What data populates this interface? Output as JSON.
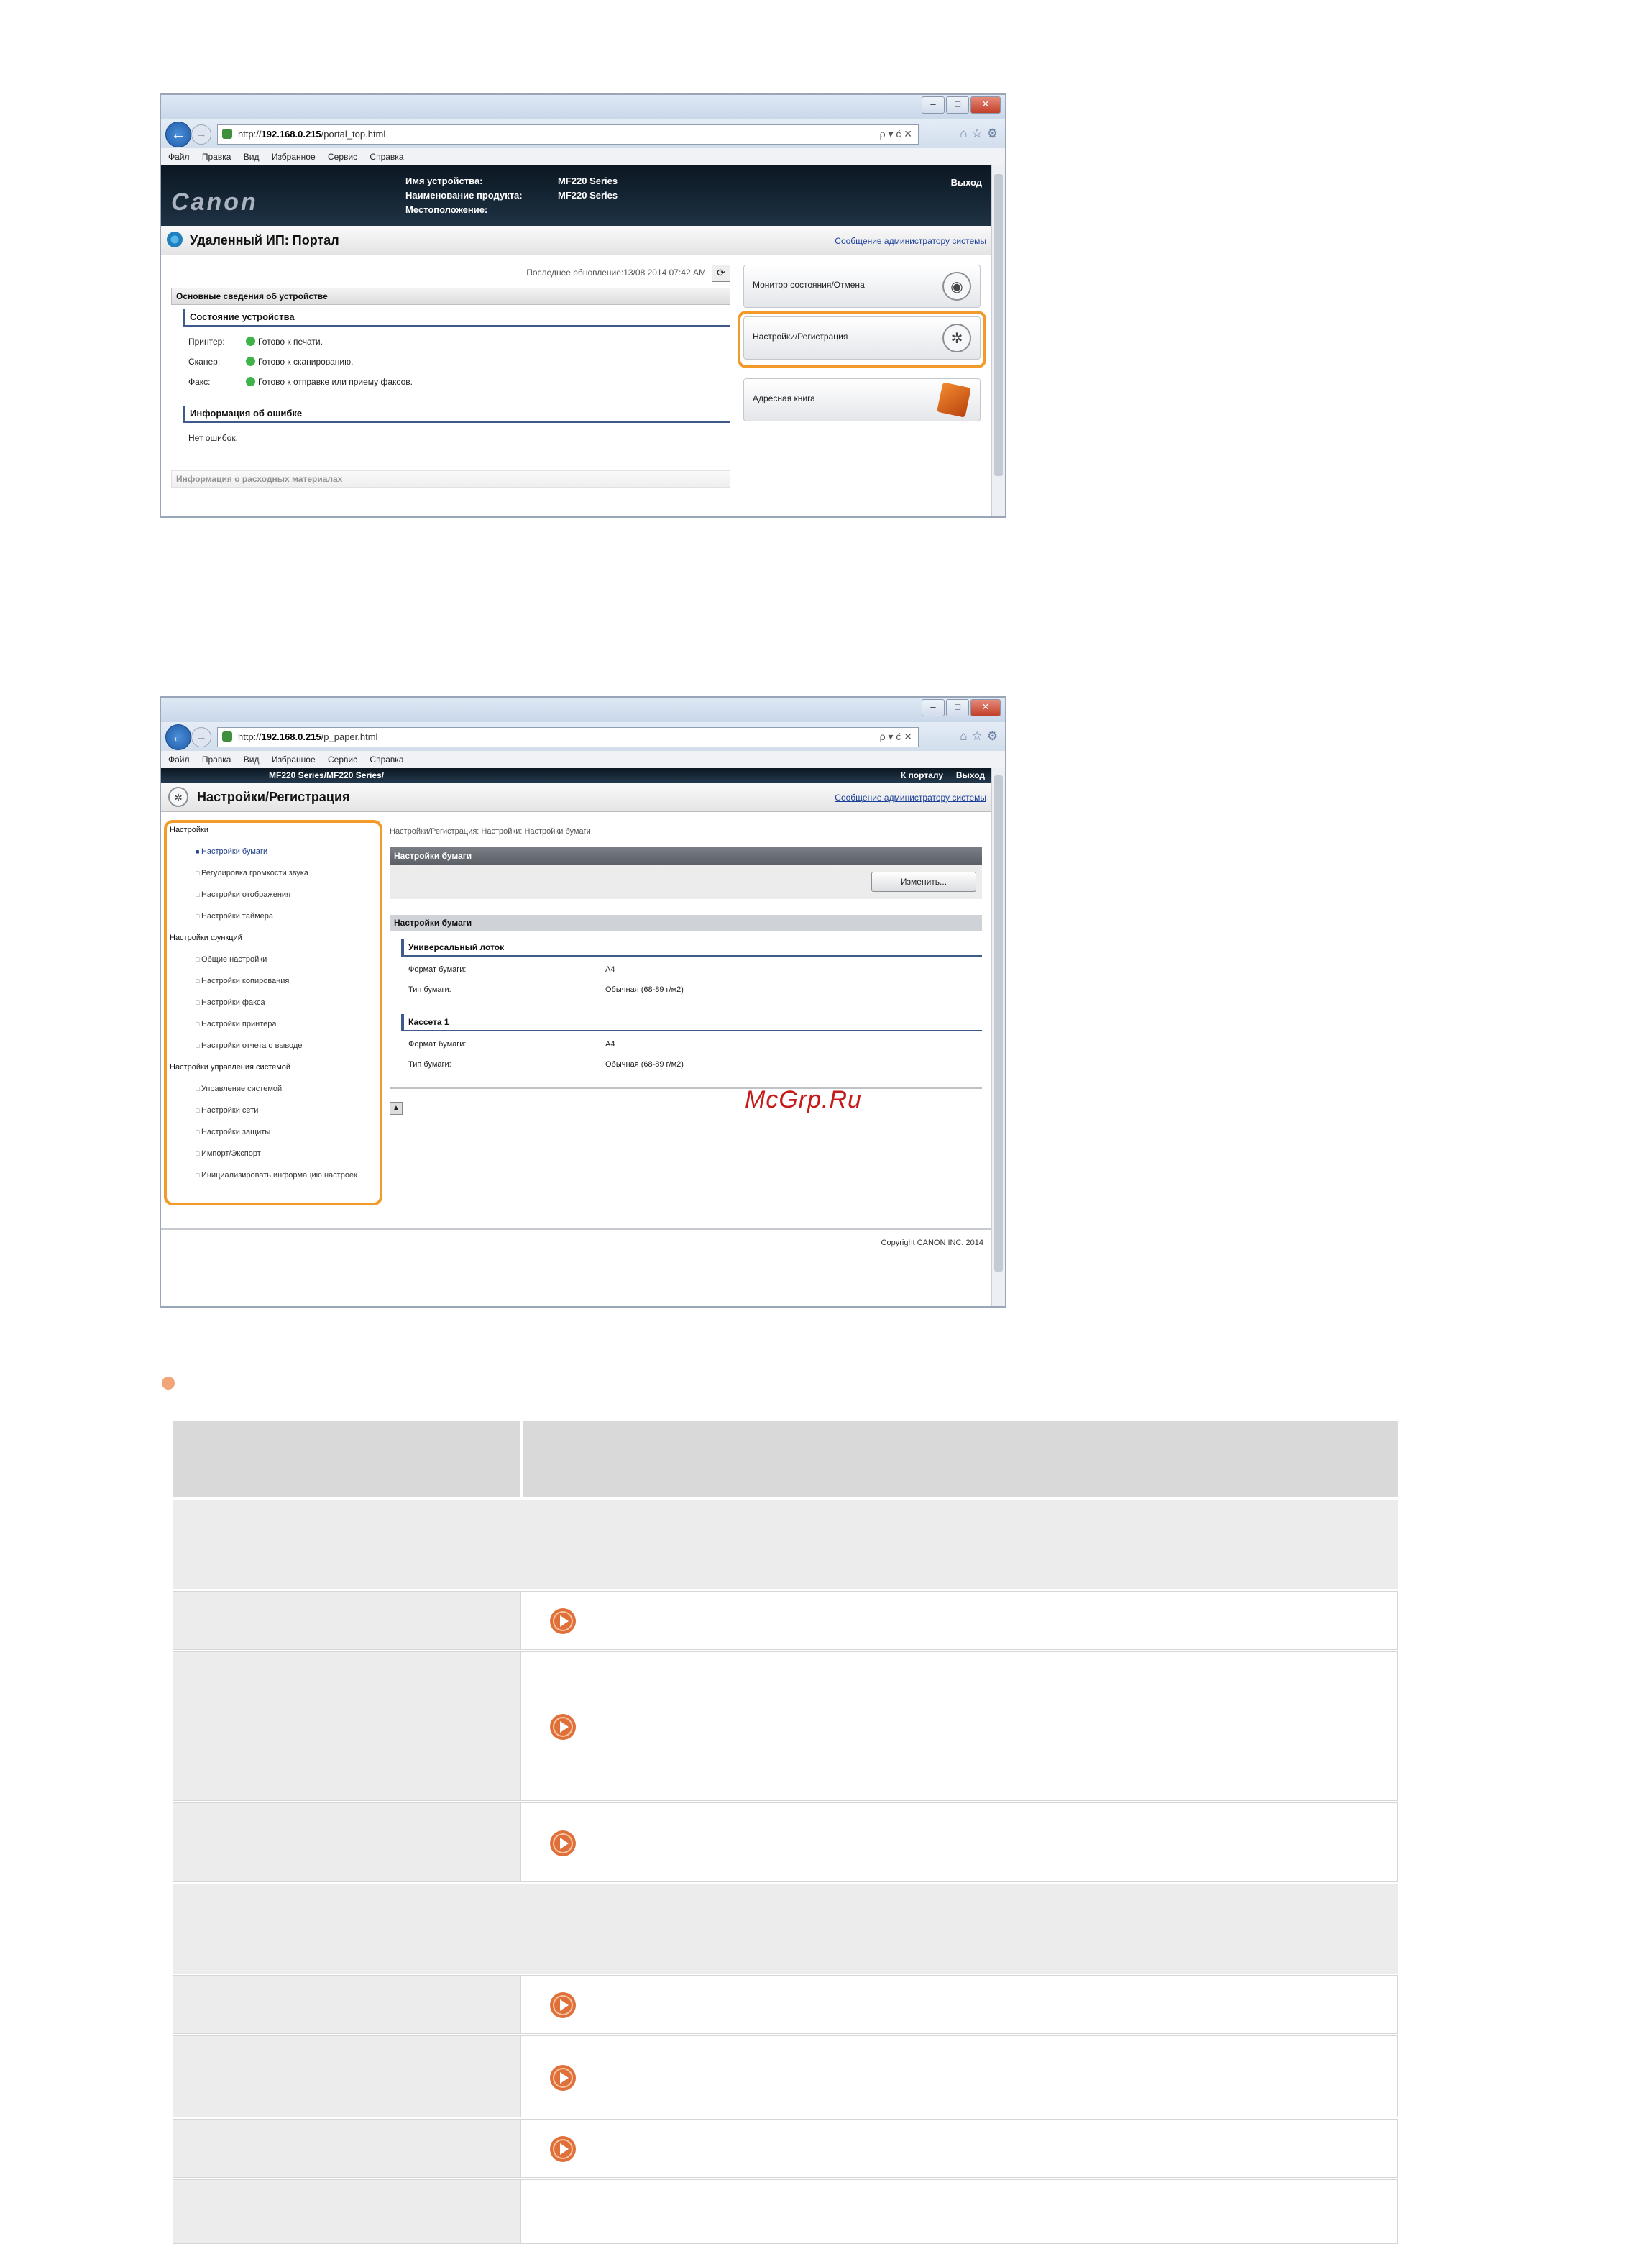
{
  "screenshot1": {
    "url_prefix": "http://",
    "url_host": "192.168.0.215",
    "url_path": "/portal_top.html",
    "addr_controls": "ρ ▾ ć ✕",
    "menu": [
      "Файл",
      "Правка",
      "Вид",
      "Избранное",
      "Сервис",
      "Справка"
    ],
    "device_labels": [
      "Имя устройства:",
      "Наименование продукта:",
      "Местоположение:"
    ],
    "device_values": [
      "MF220 Series",
      "MF220 Series",
      ""
    ],
    "logout": "Выход",
    "page_title": "Удаленный ИП: Портал",
    "admin_link": "Сообщение администратору системы",
    "last_update": "Последнее обновление:13/08 2014 07:42 AM",
    "section_basic": "Основные сведения об устройстве",
    "section_status": "Состояние устройства",
    "status_rows": [
      {
        "key": "Принтер:",
        "value": "Готово к печати."
      },
      {
        "key": "Сканер:",
        "value": "Готово к сканированию."
      },
      {
        "key": "Факс:",
        "value": "Готово к отправке или приему факсов."
      }
    ],
    "section_errors": "Информация об ошибке",
    "no_errors": "Нет ошибок.",
    "section_consumables": "Информация о расходных материалах",
    "side_cards": [
      "Монитор состояния/Отмена",
      "Настройки/Регистрация",
      "Адресная книга"
    ]
  },
  "screenshot2": {
    "url_prefix": "http://",
    "url_host": "192.168.0.215",
    "url_path": "/p_paper.html",
    "addr_controls": "ρ ▾ ć ✕",
    "menu": [
      "Файл",
      "Правка",
      "Вид",
      "Избранное",
      "Сервис",
      "Справка"
    ],
    "nav_path": "MF220 Series/MF220 Series/",
    "to_portal": "К порталу",
    "logout": "Выход",
    "page_title": "Настройки/Регистрация",
    "admin_link": "Сообщение администратору системы",
    "nav_groups": [
      {
        "label": "Настройки",
        "items": [
          "Настройки бумаги",
          "Регулировка громкости звука",
          "Настройки отображения",
          "Настройки таймера"
        ]
      },
      {
        "label": "Настройки функций",
        "items": [
          "Общие настройки",
          "Настройки копирования",
          "Настройки факса",
          "Настройки принтера",
          "Настройки отчета о выводе"
        ]
      },
      {
        "label": "Настройки управления системой",
        "items": [
          "Управление системой",
          "Настройки сети",
          "Настройки защиты",
          "Импорт/Экспорт",
          "Инициализировать информацию настроек"
        ]
      }
    ],
    "breadcrumb": "Настройки/Регистрация: Настройки: Настройки бумаги",
    "header_bar": "Настройки бумаги",
    "change_button": "Изменить...",
    "section_bar": "Настройки бумаги",
    "subsection1": "Универсальный лоток",
    "rows1": [
      {
        "key": "Формат бумаги:",
        "value": "A4"
      },
      {
        "key": "Тип бумаги:",
        "value": "Обычная (68-89 г/м2)"
      }
    ],
    "subsection2": "Кассета 1",
    "rows2": [
      {
        "key": "Формат бумаги:",
        "value": "A4"
      },
      {
        "key": "Тип бумаги:",
        "value": "Обычная (68-89 г/м2)"
      }
    ],
    "copyright": "Copyright CANON INC. 2014"
  },
  "watermark": "McGrp.Ru"
}
